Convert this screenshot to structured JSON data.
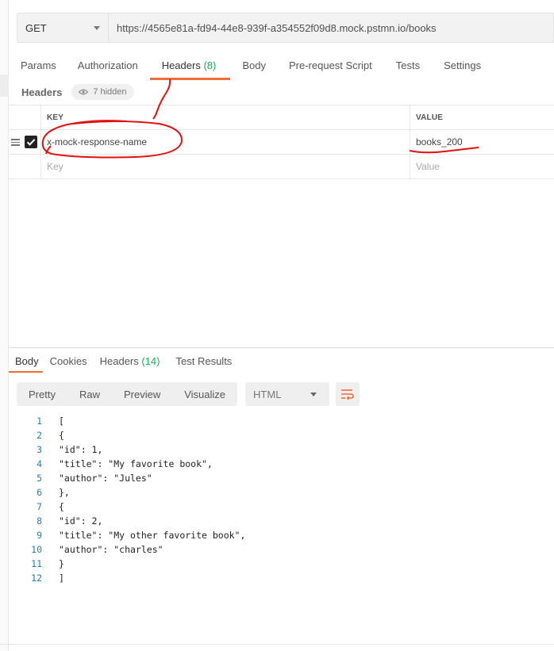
{
  "request": {
    "method": "GET",
    "url": "https://4565e81a-fd94-44e8-939f-a354552f09d8.mock.pstmn.io/books"
  },
  "request_tabs": [
    {
      "label": "Params",
      "count": ""
    },
    {
      "label": "Authorization",
      "count": ""
    },
    {
      "label": "Headers",
      "count": "(8)"
    },
    {
      "label": "Body",
      "count": ""
    },
    {
      "label": "Pre-request Script",
      "count": ""
    },
    {
      "label": "Tests",
      "count": ""
    },
    {
      "label": "Settings",
      "count": ""
    }
  ],
  "headers_section": {
    "label": "Headers",
    "hidden_text": "7 hidden"
  },
  "kv_table": {
    "key_header": "KEY",
    "value_header": "VALUE",
    "rows": [
      {
        "key": "x-mock-response-name",
        "value": "books_200",
        "checked": true
      }
    ],
    "key_placeholder": "Key",
    "value_placeholder": "Value"
  },
  "response_tabs": [
    {
      "label": "Body",
      "count": ""
    },
    {
      "label": "Cookies",
      "count": ""
    },
    {
      "label": "Headers",
      "count": "(14)"
    },
    {
      "label": "Test Results",
      "count": ""
    }
  ],
  "view_modes": [
    "Pretty",
    "Raw",
    "Preview",
    "Visualize"
  ],
  "format": "HTML",
  "code_lines": [
    "[",
    "{",
    "\"id\": 1,",
    "\"title\": \"My favorite book\",",
    "\"author\": \"Jules\"",
    "},",
    "{",
    "\"id\": 2,",
    "\"title\": \"My other favorite book\",",
    "\"author\": \"charles\"",
    "}",
    "]"
  ],
  "colors": {
    "accent": "#f26b3a",
    "count_green": "#26a65b",
    "line_number": "#2a7ab0",
    "annotation_red": "#e01010"
  }
}
